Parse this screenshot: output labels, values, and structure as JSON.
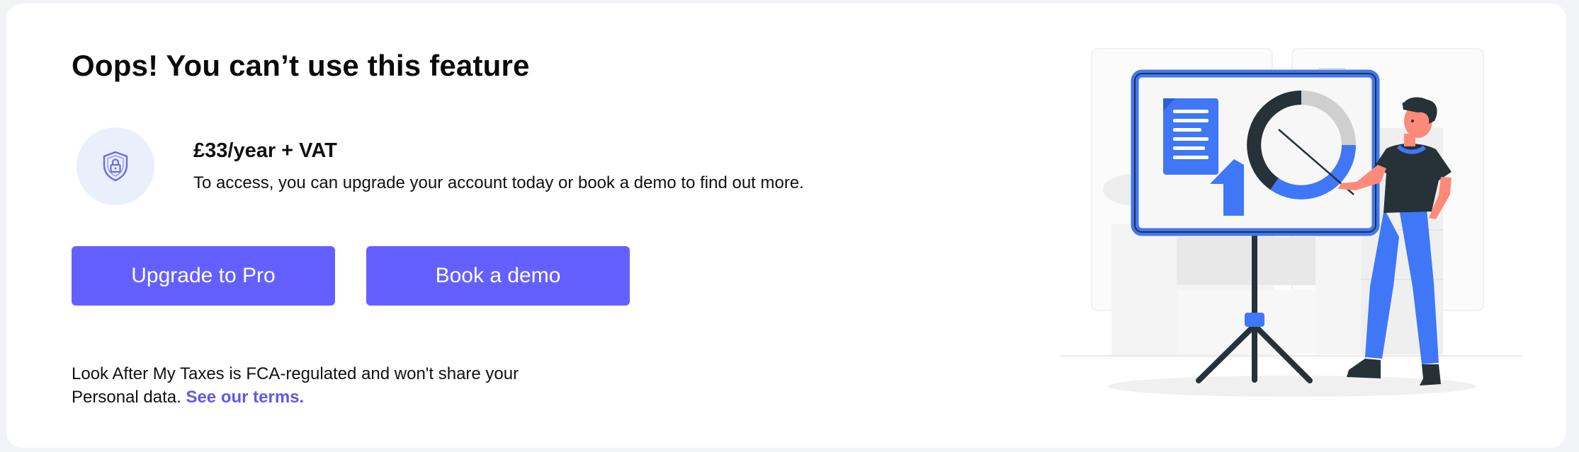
{
  "modal": {
    "title": "Oops! You can’t use this feature",
    "price": "£33/year + VAT",
    "description": "To access, you can upgrade your account today or book a demo to find out more.",
    "upgrade_label": "Upgrade to Pro",
    "demo_label": "Book a demo",
    "legal_text": "Look After My Taxes is FCA-regulated and won't share your Personal data.",
    "terms_link": "See our terms."
  },
  "icons": {
    "lock": "shield-lock-icon",
    "illustration": "presenter-with-chart-illustration"
  },
  "colors": {
    "accent": "#6460ff",
    "link": "#5e5ae8",
    "illustration_blue": "#3f77f7",
    "lock_bg": "#e9effb"
  }
}
